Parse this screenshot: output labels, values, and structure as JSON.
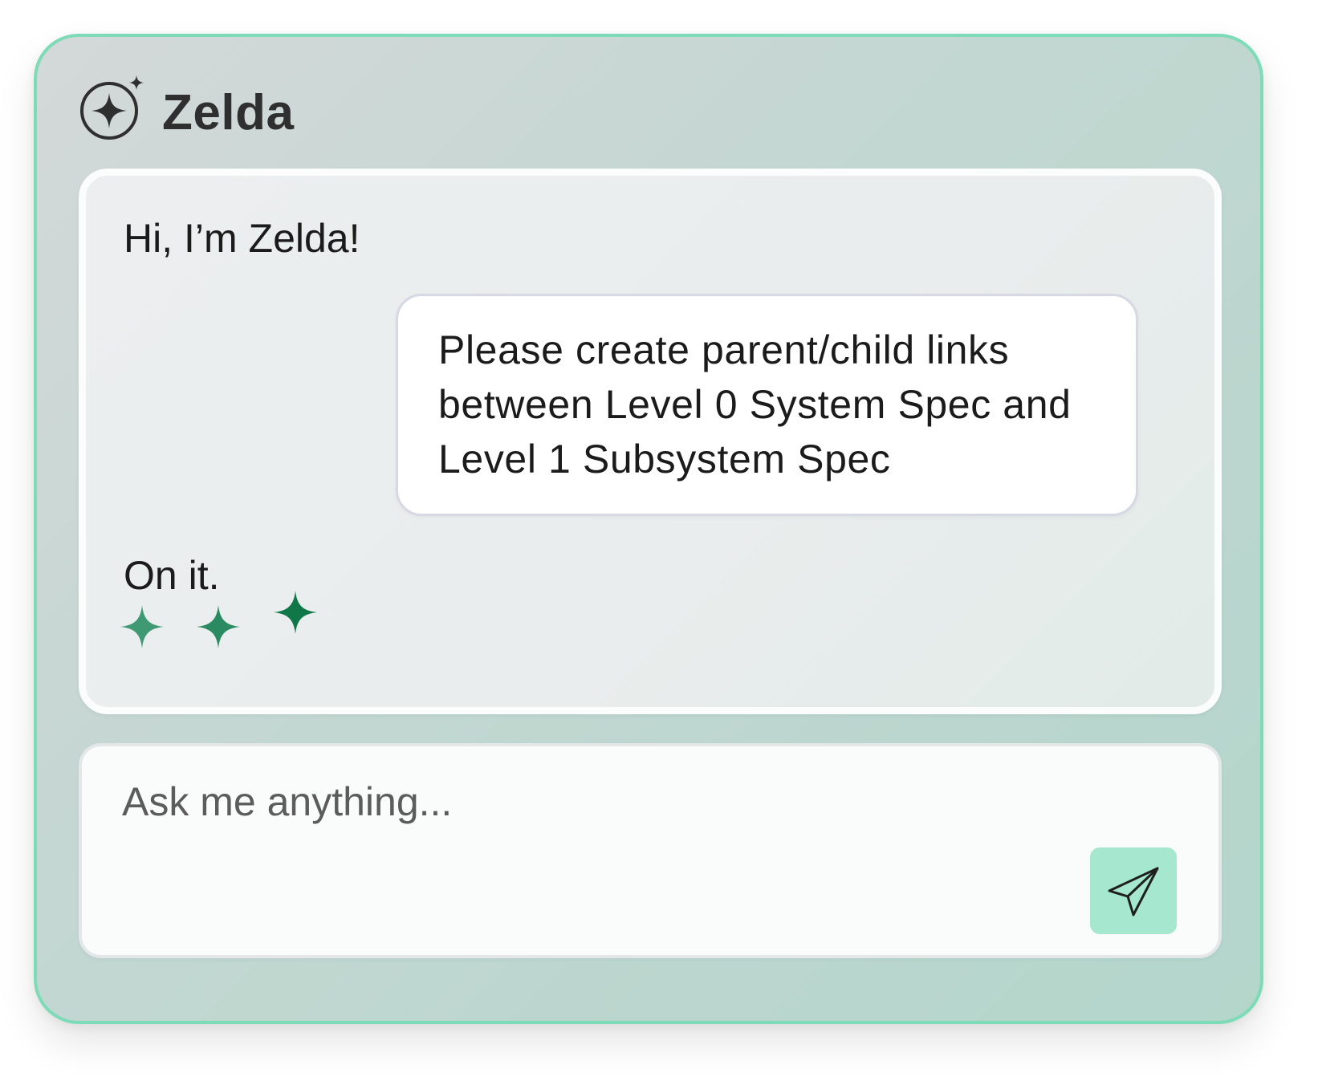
{
  "header": {
    "title": "Zelda",
    "logo_icon": "sparkle-circle-icon"
  },
  "messages": {
    "greeting": "Hi, I’m Zelda!",
    "user_request": "Please create parent/child links between Level 0 System Spec and Level 1 Subsystem Spec",
    "assistant_reply": "On it.",
    "typing_indicator_icon": "sparkle-icon"
  },
  "input": {
    "placeholder": "Ask me anything...",
    "value": ""
  },
  "send_button": {
    "icon": "send-icon"
  },
  "colors": {
    "accent": "#7ddcb7",
    "send_button_bg": "#a5e8cf",
    "sparkle_light": "#3f9a74",
    "sparkle_mid": "#2a8a61",
    "sparkle_dark": "#0f7748"
  }
}
